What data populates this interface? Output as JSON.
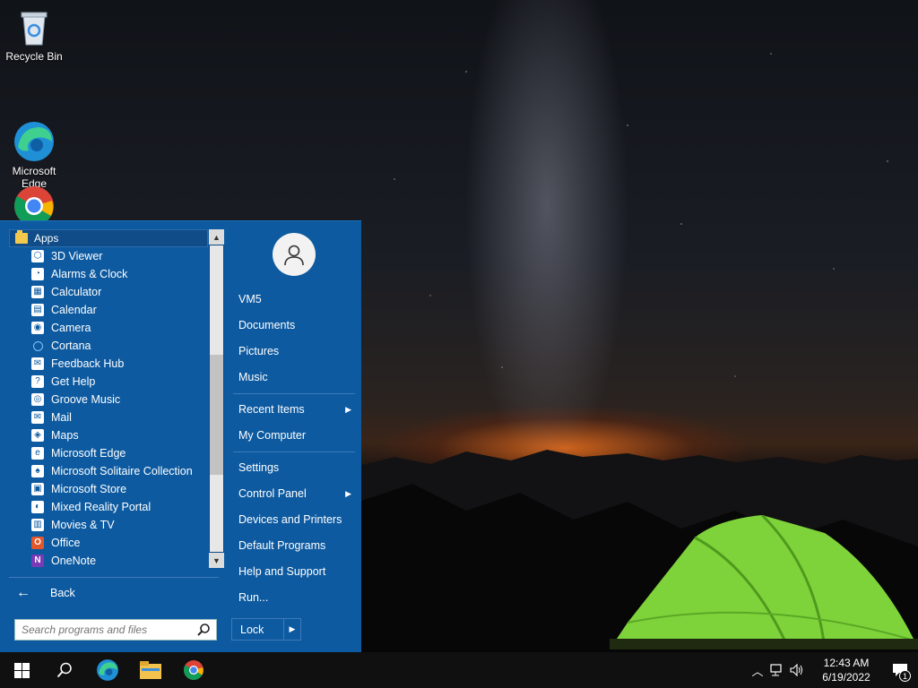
{
  "desktop": {
    "icons": [
      {
        "label": "Recycle Bin",
        "icon": "recycle-bin-icon"
      },
      {
        "label": "Microsoft\nEdge",
        "icon": "edge-icon"
      },
      {
        "label": "",
        "icon": "chrome-icon"
      }
    ]
  },
  "start_menu": {
    "apps_header": "Apps",
    "apps": [
      {
        "label": "3D Viewer",
        "icon": "cube-icon",
        "color": "#ffffff"
      },
      {
        "label": "Alarms & Clock",
        "icon": "clock-icon",
        "color": "#ffffff"
      },
      {
        "label": "Calculator",
        "icon": "calculator-icon",
        "color": "#ffffff"
      },
      {
        "label": "Calendar",
        "icon": "calendar-icon",
        "color": "#ffffff"
      },
      {
        "label": "Camera",
        "icon": "camera-icon",
        "color": "#ffffff"
      },
      {
        "label": "Cortana",
        "icon": "cortana-icon",
        "color": "#7fc3ff"
      },
      {
        "label": "Feedback Hub",
        "icon": "feedback-icon",
        "color": "#ffffff"
      },
      {
        "label": "Get Help",
        "icon": "help-icon",
        "color": "#ffffff"
      },
      {
        "label": "Groove Music",
        "icon": "music-icon",
        "color": "#ffffff"
      },
      {
        "label": "Mail",
        "icon": "mail-icon",
        "color": "#ffffff"
      },
      {
        "label": "Maps",
        "icon": "maps-icon",
        "color": "#ffffff"
      },
      {
        "label": "Microsoft Edge",
        "icon": "edge-icon",
        "color": "#ffffff"
      },
      {
        "label": "Microsoft Solitaire Collection",
        "icon": "cards-icon",
        "color": "#ffffff"
      },
      {
        "label": "Microsoft Store",
        "icon": "store-icon",
        "color": "#ffffff"
      },
      {
        "label": "Mixed Reality Portal",
        "icon": "headset-icon",
        "color": "#ffffff"
      },
      {
        "label": "Movies & TV",
        "icon": "film-icon",
        "color": "#ffffff"
      },
      {
        "label": "Office",
        "icon": "office-icon",
        "color": "#e3572b"
      },
      {
        "label": "OneNote",
        "icon": "onenote-icon",
        "color": "#7b3ab5"
      }
    ],
    "back_label": "Back",
    "search_placeholder": "Search programs and files",
    "user": {
      "name": "VM5"
    },
    "right_items": [
      {
        "label": "Documents"
      },
      {
        "label": "Pictures"
      },
      {
        "label": "Music"
      },
      {
        "label": "Recent Items",
        "submenu": true
      },
      {
        "label": "My Computer"
      },
      {
        "label": "Settings"
      },
      {
        "label": "Control Panel",
        "submenu": true
      },
      {
        "label": "Devices and Printers"
      },
      {
        "label": "Default Programs"
      },
      {
        "label": "Help and Support"
      },
      {
        "label": "Run..."
      }
    ],
    "lock_label": "Lock"
  },
  "taskbar": {
    "time": "12:43 AM",
    "date": "6/19/2022",
    "notification_count": "1"
  },
  "colors": {
    "menu_bg": "#0d5aa0",
    "taskbar_bg": "#101010"
  }
}
